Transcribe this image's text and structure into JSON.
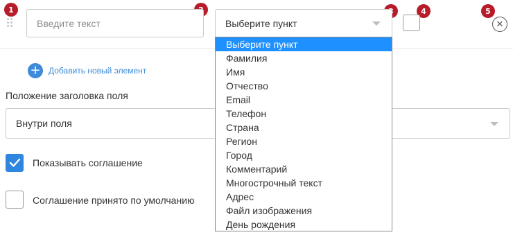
{
  "badges": [
    "1",
    "2",
    "3",
    "4",
    "5"
  ],
  "field_row": {
    "text_placeholder": "Введите текст",
    "type_select_value": "Выберите пункт"
  },
  "dropdown": {
    "options": [
      "Выберите пункт",
      "Фамилия",
      "Имя",
      "Отчество",
      "Email",
      "Телефон",
      "Страна",
      "Регион",
      "Город",
      "Комментарий",
      "Многострочный текст",
      "Адрес",
      "Файл изображения",
      "День рождения"
    ],
    "selected_index": 0
  },
  "add_element": {
    "label": "Добавить новый элемент"
  },
  "title_position": {
    "label": "Положение заголовка поля",
    "value": "Внутри поля"
  },
  "show_agreement": {
    "label": "Показывать соглашение",
    "checked": true
  },
  "agreement_default": {
    "label": "Соглашение принято по умолчанию",
    "checked": false
  },
  "colors": {
    "badge": "#b71c2b",
    "accent": "#2e86de",
    "link": "#3d8bd9",
    "selected_option": "#1e90ff"
  }
}
